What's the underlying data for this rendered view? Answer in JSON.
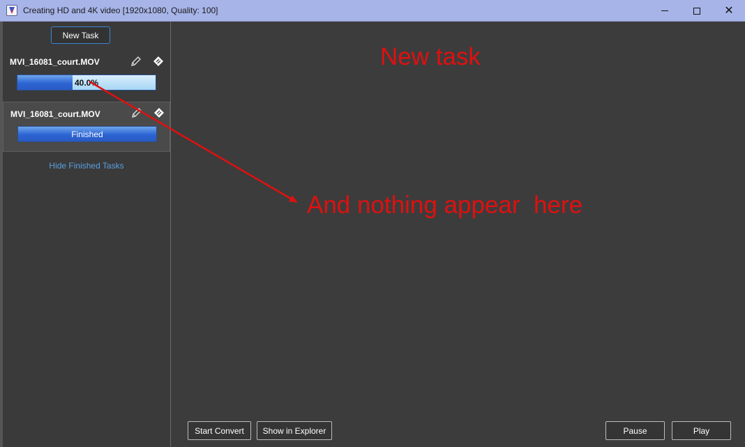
{
  "window": {
    "title": "Creating HD and 4K video [1920x1080, Quality: 100]",
    "controls": {
      "minimize": "–",
      "maximize": "□",
      "close": "✕"
    }
  },
  "sidebar": {
    "new_task_label": "New Task",
    "tasks": [
      {
        "name": "MVI_16081_court.MOV",
        "progress_label": "40.0%",
        "progress_fraction": 0.4,
        "icons": [
          "pencil-icon",
          "tag-icon"
        ]
      },
      {
        "name": "MVI_16081_court.MOV",
        "progress_label": "Finished",
        "progress_fraction": 1.0,
        "icons": [
          "pencil-icon",
          "tag-icon"
        ]
      }
    ],
    "hide_finished_label": "Hide Finished Tasks"
  },
  "main": {
    "buttons": {
      "start_convert": "Start Convert",
      "show_in_explorer": "Show in Explorer",
      "pause": "Pause",
      "play": "Play"
    }
  },
  "annotations": {
    "new_task": "New task",
    "nothing_appear": "And nothing appear  here"
  },
  "colors": {
    "titlebar": "#a7b4e8",
    "annotation": "#e01010",
    "accent": "#3b86d6",
    "link": "#5aa0e0"
  }
}
